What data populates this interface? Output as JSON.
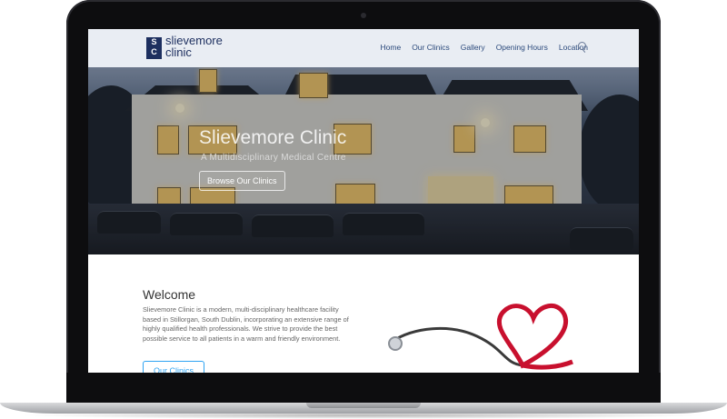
{
  "brand": {
    "logo_letters_top": "S",
    "logo_letters_bottom": "C",
    "line1": "slievemore",
    "line2": "clinic"
  },
  "nav": {
    "items": [
      "Home",
      "Our Clinics",
      "Gallery",
      "Opening Hours",
      "Location"
    ]
  },
  "hero": {
    "title": "Slievemore Clinic",
    "subtitle": "A Multidisciplinary Medical Centre",
    "button": "Browse Our Clinics"
  },
  "welcome": {
    "title": "Welcome",
    "text": "Slievemore Clinic is a modern, multi-disciplinary healthcare facility based in Stillorgan, South Dublin, incorporating an extensive range of highly qualified health professionals. We strive to provide the best possible service to all patients in a warm and friendly environment.",
    "button": "Our Clinics"
  },
  "icons": {
    "search": "search-icon",
    "stethoscope": "stethoscope-heart-image"
  },
  "colors": {
    "brand": "#1d2f5f",
    "nav_link": "#2c4a7c",
    "accent": "#2ea3f2",
    "heart": "#c8102e"
  }
}
